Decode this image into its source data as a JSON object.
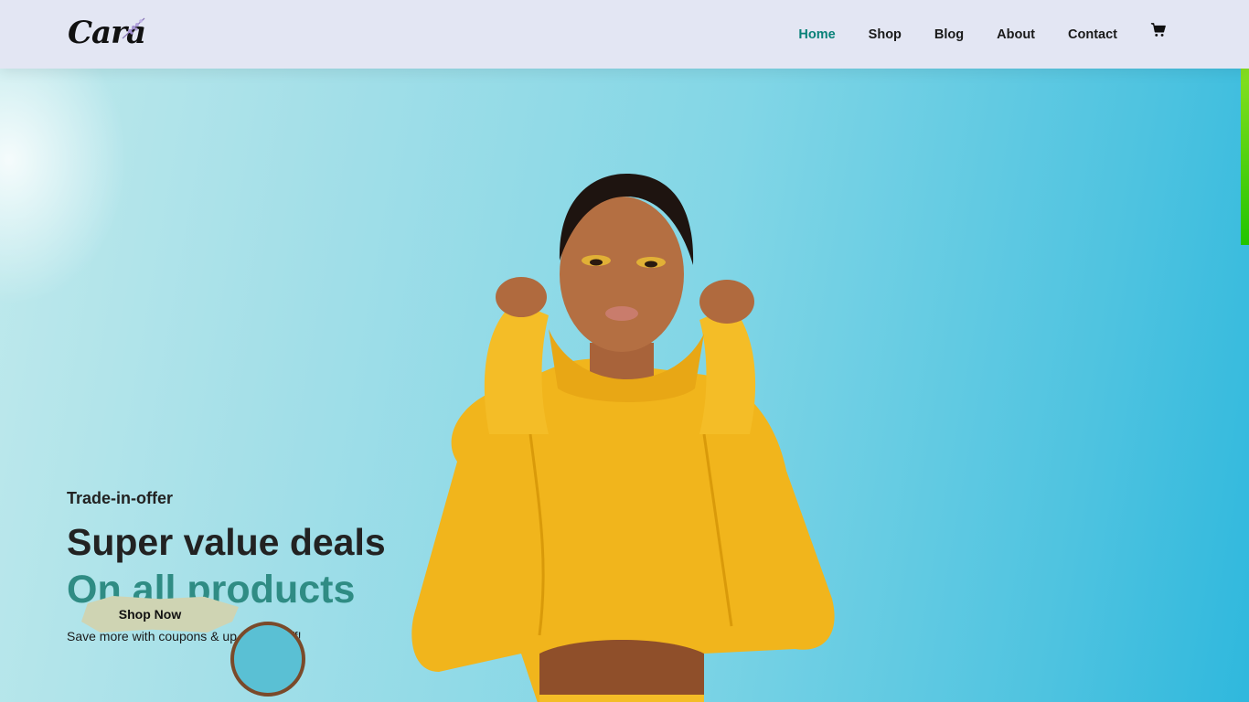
{
  "header": {
    "logo_text": "Cara",
    "nav": [
      {
        "label": "Home",
        "active": true
      },
      {
        "label": "Shop",
        "active": false
      },
      {
        "label": "Blog",
        "active": false
      },
      {
        "label": "About",
        "active": false
      },
      {
        "label": "Contact",
        "active": false
      }
    ],
    "cart_icon": "cart-icon"
  },
  "hero": {
    "tagline": "Trade-in-offer",
    "headline": "Super value deals",
    "highlight": "On all products",
    "subtext": "Save more with coupons & up to 70% off!",
    "button_label": "Shop Now"
  },
  "colors": {
    "accent": "#088178",
    "highlight": "#2f8c84",
    "header_bg": "#e3e6f3"
  }
}
